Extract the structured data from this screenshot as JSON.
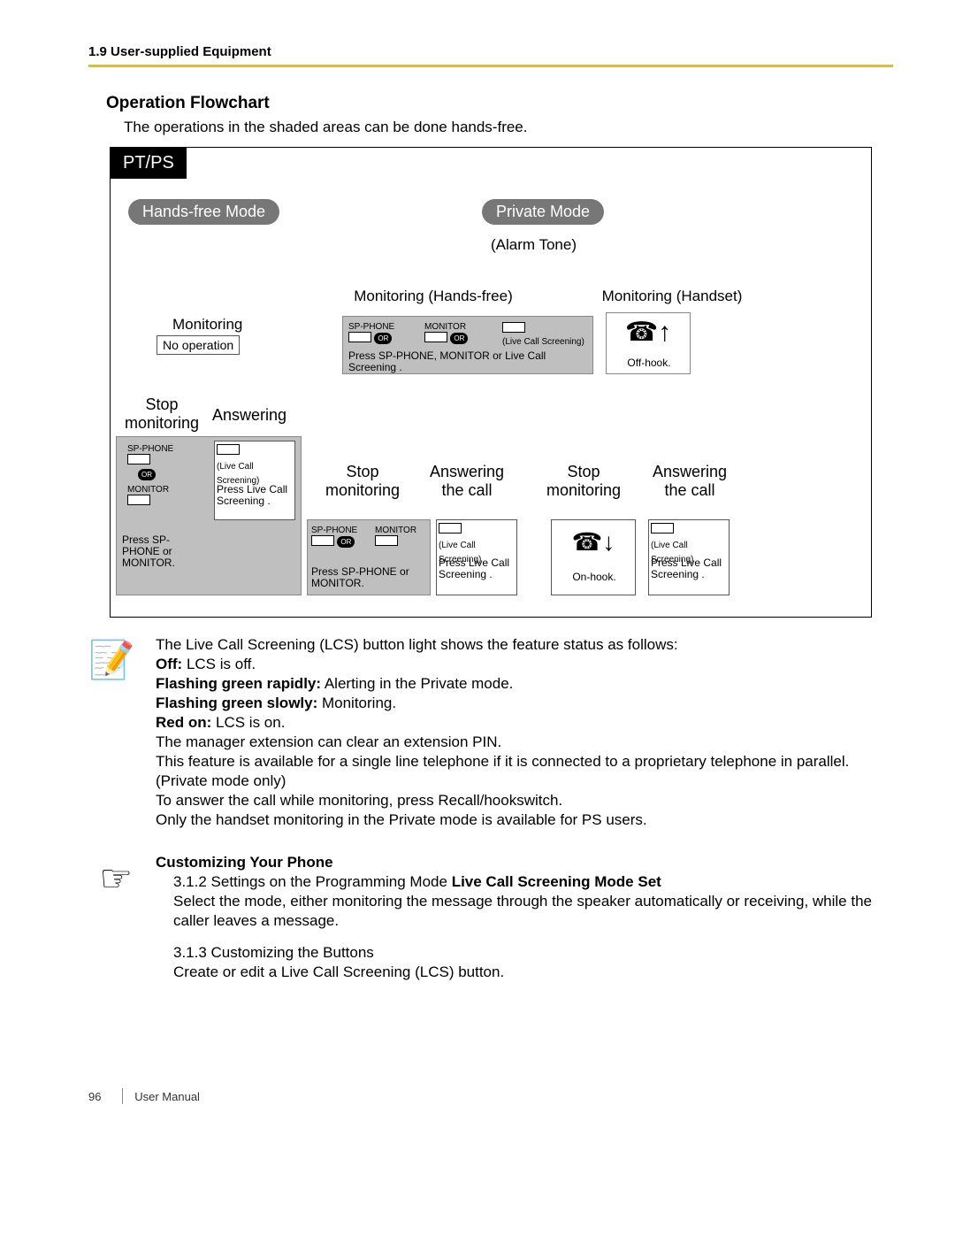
{
  "header": {
    "section": "1.9 User-supplied Equipment"
  },
  "title": "Operation Flowchart",
  "intro": "The operations in the shaded areas can be done hands-free.",
  "flow": {
    "ptps": "PT/PS",
    "hf": "Hands-free Mode",
    "pm": "Private Mode",
    "alarm": "(Alarm Tone)",
    "mon_hf": "Monitoring (Hands-free)",
    "mon_hs": "Monitoring (Handset)",
    "monitoring": "Monitoring",
    "noop": "No operation",
    "stop_mon": "Stop monitoring",
    "answering": "Answering",
    "answering_call": "Answering the call",
    "press_sp_mon_lcs": "Press SP-PHONE, MONITOR or Live Call Screening .",
    "press_lcs": "Press Live Call Screening .",
    "press_sp_mon": "Press SP-PHONE or MONITOR.",
    "press_lcs_short": "Press Live Call Screening .",
    "offhook": "Off-hook.",
    "onhook": "On-hook.",
    "spphone": "SP-PHONE",
    "monitor": "MONITOR",
    "lcs_small": "(Live Call Screening)",
    "or": "OR",
    "press_sp_or_mon": "Press SP-PHONE or MONITOR."
  },
  "notes": {
    "l1": "The Live Call Screening (LCS) button light shows the feature status as follows:",
    "off_b": "Off:",
    "off_t": " LCS is off.",
    "fgr_b": "Flashing green rapidly:",
    "fgr_t": " Alerting in the Private mode.",
    "fgs_b": "Flashing green slowly:",
    "fgs_t": " Monitoring.",
    "red_b": "Red on:",
    "red_t": " LCS is on.",
    "mgr": "The manager extension can clear an extension PIN.",
    "feat1": "This feature is available for a single line telephone if it is connected to a proprietary telephone in parallel. (Private mode only)",
    "feat2": "To answer the call while monitoring, press Recall/hookswitch.",
    "only": "Only the handset monitoring in the Private mode is available for PS users."
  },
  "cust": {
    "heading": "Customizing Your Phone",
    "p1a": "3.1.2 Settings on the Programming Mode    ",
    "p1b": "Live Call Screening Mode Set",
    "p2": "Select the mode, either monitoring the message through the speaker automatically or receiving, while the caller leaves a message.",
    "p3": "3.1.3 Customizing the Buttons",
    "p4": "Create or edit a Live Call Screening (LCS) button."
  },
  "footer": {
    "page": "96",
    "label": "User Manual"
  }
}
